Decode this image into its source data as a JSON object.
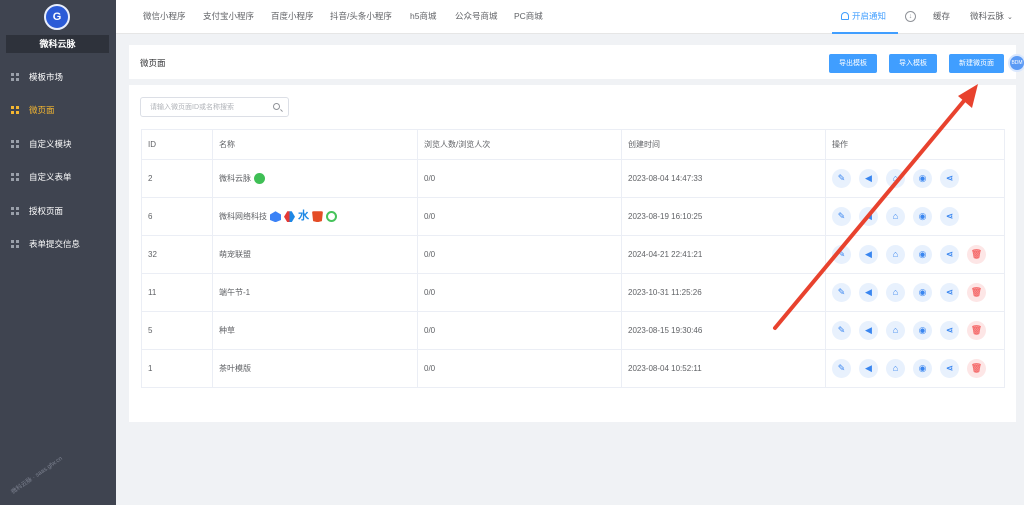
{
  "sidebar": {
    "logo_text": "G",
    "brand": "微科云脉",
    "items": [
      {
        "label": "模板市场",
        "active": false
      },
      {
        "label": "微页面",
        "active": true
      },
      {
        "label": "自定义模块",
        "active": false
      },
      {
        "label": "自定义表单",
        "active": false
      },
      {
        "label": "授权页面",
        "active": false
      },
      {
        "label": "表单提交信息",
        "active": false
      }
    ],
    "watermark": "微科云脉 · saas.gfw.cn"
  },
  "topbar": {
    "tabs": [
      "微信小程序",
      "支付宝小程序",
      "百度小程序",
      "抖音/头条小程序",
      "h5商城",
      "公众号商城",
      "PC商城"
    ],
    "notify": "开启通知",
    "download_icon": "↓",
    "cache": "缓存",
    "user": "微科云脉",
    "caret": "⌄"
  },
  "header": {
    "title": "微页面",
    "export_btn": "导出模板",
    "import_btn": "导入模板",
    "new_btn": "新建微页面",
    "avatar_text": "BDM"
  },
  "search": {
    "placeholder": "请输入微页面ID或名称搜索"
  },
  "table": {
    "headers": {
      "id": "ID",
      "name": "名称",
      "views": "浏览人数/浏览人次",
      "created": "创建时间",
      "ops": "操作"
    },
    "rows": [
      {
        "id": "2",
        "name": "微科云脉",
        "views": "0/0",
        "created": "2023-08-04 14:47:33"
      },
      {
        "id": "6",
        "name": "微科网络科技",
        "views": "0/0",
        "created": "2023-08-19 16:10:25"
      },
      {
        "id": "32",
        "name": "萌宠联盟",
        "views": "0/0",
        "created": "2024-04-21 22:41:21"
      },
      {
        "id": "11",
        "name": "端午节-1",
        "views": "0/0",
        "created": "2023-10-31 11:25:26"
      },
      {
        "id": "5",
        "name": "种草",
        "views": "0/0",
        "created": "2023-08-15 19:30:46"
      },
      {
        "id": "1",
        "name": "茶叶模版",
        "views": "0/0",
        "created": "2023-08-04 10:52:11"
      }
    ],
    "op_glyphs": {
      "edit": "✎",
      "promote": "◀",
      "home": "⌂",
      "view": "◉",
      "share": "⋖",
      "delete": "🗑"
    },
    "star_glyph": "⽔"
  },
  "colors": {
    "primary": "#409eff",
    "sidebar_bg": "#3f4450",
    "active_menu": "#f5b731",
    "danger": "#f56c6c",
    "annotation_arrow": "#e8422e"
  }
}
